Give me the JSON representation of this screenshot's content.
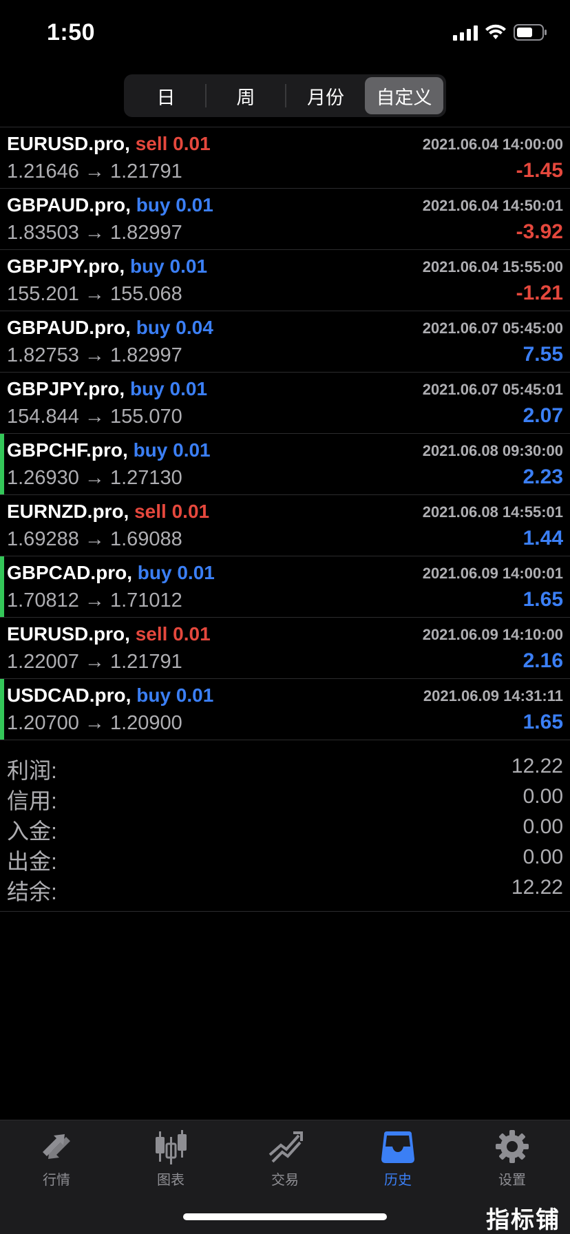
{
  "status_bar": {
    "time": "1:50"
  },
  "segments": [
    {
      "label": "日"
    },
    {
      "label": "周"
    },
    {
      "label": "月份"
    },
    {
      "label": "自定义"
    }
  ],
  "trades": [
    {
      "symbol": "EURUSD.pro,",
      "side": "sell",
      "volume": "0.01",
      "time": "2021.06.04 14:00:00",
      "prices": "1.21646 → 1.21791",
      "profit": "-1.45"
    },
    {
      "symbol": "GBPAUD.pro,",
      "side": "buy",
      "volume": "0.01",
      "time": "2021.06.04 14:50:01",
      "prices": "1.83503 → 1.82997",
      "profit": "-3.92"
    },
    {
      "symbol": "GBPJPY.pro,",
      "side": "buy",
      "volume": "0.01",
      "time": "2021.06.04 15:55:00",
      "prices": "155.201 → 155.068",
      "profit": "-1.21"
    },
    {
      "symbol": "GBPAUD.pro,",
      "side": "buy",
      "volume": "0.04",
      "time": "2021.06.07 05:45:00",
      "prices": "1.82753 → 1.82997",
      "profit": "7.55"
    },
    {
      "symbol": "GBPJPY.pro,",
      "side": "buy",
      "volume": "0.01",
      "time": "2021.06.07 05:45:01",
      "prices": "154.844 → 155.070",
      "profit": "2.07"
    },
    {
      "symbol": "GBPCHF.pro,",
      "side": "buy",
      "volume": "0.01",
      "time": "2021.06.08 09:30:00",
      "prices": "1.26930 → 1.27130",
      "profit": "2.23"
    },
    {
      "symbol": "EURNZD.pro,",
      "side": "sell",
      "volume": "0.01",
      "time": "2021.06.08 14:55:01",
      "prices": "1.69288 → 1.69088",
      "profit": "1.44"
    },
    {
      "symbol": "GBPCAD.pro,",
      "side": "buy",
      "volume": "0.01",
      "time": "2021.06.09 14:00:01",
      "prices": "1.70812 → 1.71012",
      "profit": "1.65"
    },
    {
      "symbol": "EURUSD.pro,",
      "side": "sell",
      "volume": "0.01",
      "time": "2021.06.09 14:10:00",
      "prices": "1.22007 → 1.21791",
      "profit": "2.16"
    },
    {
      "symbol": "USDCAD.pro,",
      "side": "buy",
      "volume": "0.01",
      "time": "2021.06.09 14:31:11",
      "prices": "1.20700 → 1.20900",
      "profit": "1.65"
    }
  ],
  "summary": [
    {
      "label": "利润:",
      "value": "12.22"
    },
    {
      "label": "信用:",
      "value": "0.00"
    },
    {
      "label": "入金:",
      "value": "0.00"
    },
    {
      "label": "出金:",
      "value": "0.00"
    },
    {
      "label": "结余:",
      "value": "12.22"
    }
  ],
  "tabs": [
    {
      "label": "行情",
      "icon": "quotes-icon"
    },
    {
      "label": "图表",
      "icon": "chart-icon"
    },
    {
      "label": "交易",
      "icon": "trade-icon"
    },
    {
      "label": "历史",
      "icon": "history-icon"
    },
    {
      "label": "设置",
      "icon": "settings-icon"
    }
  ],
  "watermark": "指标铺",
  "colors": {
    "sell": "#e5483d",
    "buy": "#3b7ff5",
    "accent": "#3b7ff5",
    "marker": "#34c759"
  }
}
